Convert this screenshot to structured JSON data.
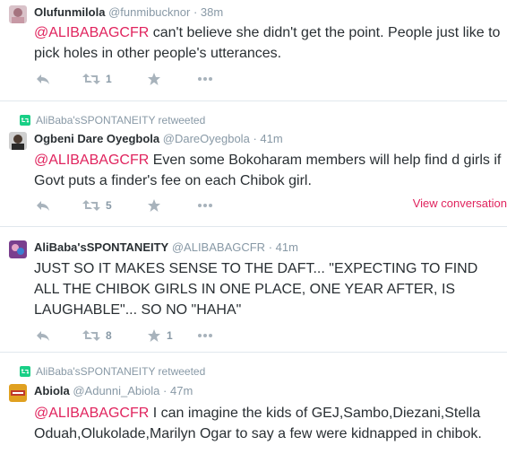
{
  "accent": "#e0245e",
  "tweets": [
    {
      "display_name": "Olufunmilola",
      "handle": "@funmibucknor",
      "separator": "·",
      "time": "38m",
      "mention": "@ALIBABAGCFR",
      "text": " can't believe she didn't get the point. People just like to pick holes in other people's utterances.",
      "retweet_count": "1",
      "favorite_count": ""
    },
    {
      "retweeted_by": "AliBaba'sSPONTANEITY retweeted",
      "display_name": "Ogbeni Dare Oyegbola",
      "handle": "@DareOyegbola",
      "separator": "·",
      "time": "41m",
      "mention": "@ALIBABAGCFR",
      "text": " Even some Bokoharam members will help find d girls if Govt puts a finder's fee on each Chibok girl.",
      "retweet_count": "5",
      "favorite_count": "",
      "view_conversation": "View conversation"
    },
    {
      "display_name": "AliBaba'sSPONTANEITY",
      "handle": "@ALIBABAGCFR",
      "separator": "·",
      "time": "41m",
      "mention": "",
      "text": "JUST SO IT MAKES SENSE TO THE DAFT... \"EXPECTING TO FIND ALL THE CHIBOK GIRLS IN ONE PLACE, ONE YEAR AFTER, IS LAUGHABLE\"... SO NO \"HAHA\"",
      "retweet_count": "8",
      "favorite_count": "1"
    },
    {
      "retweeted_by": "AliBaba'sSPONTANEITY retweeted",
      "display_name": "Abiola",
      "handle": "@Adunni_Abiola",
      "separator": "·",
      "time": "47m",
      "mention": "@ALIBABAGCFR",
      "text": " I can imagine the kids of GEJ,Sambo,Diezani,Stella Oduah,Olukolade,Marilyn Ogar to say a few were kidnapped in chibok."
    }
  ]
}
